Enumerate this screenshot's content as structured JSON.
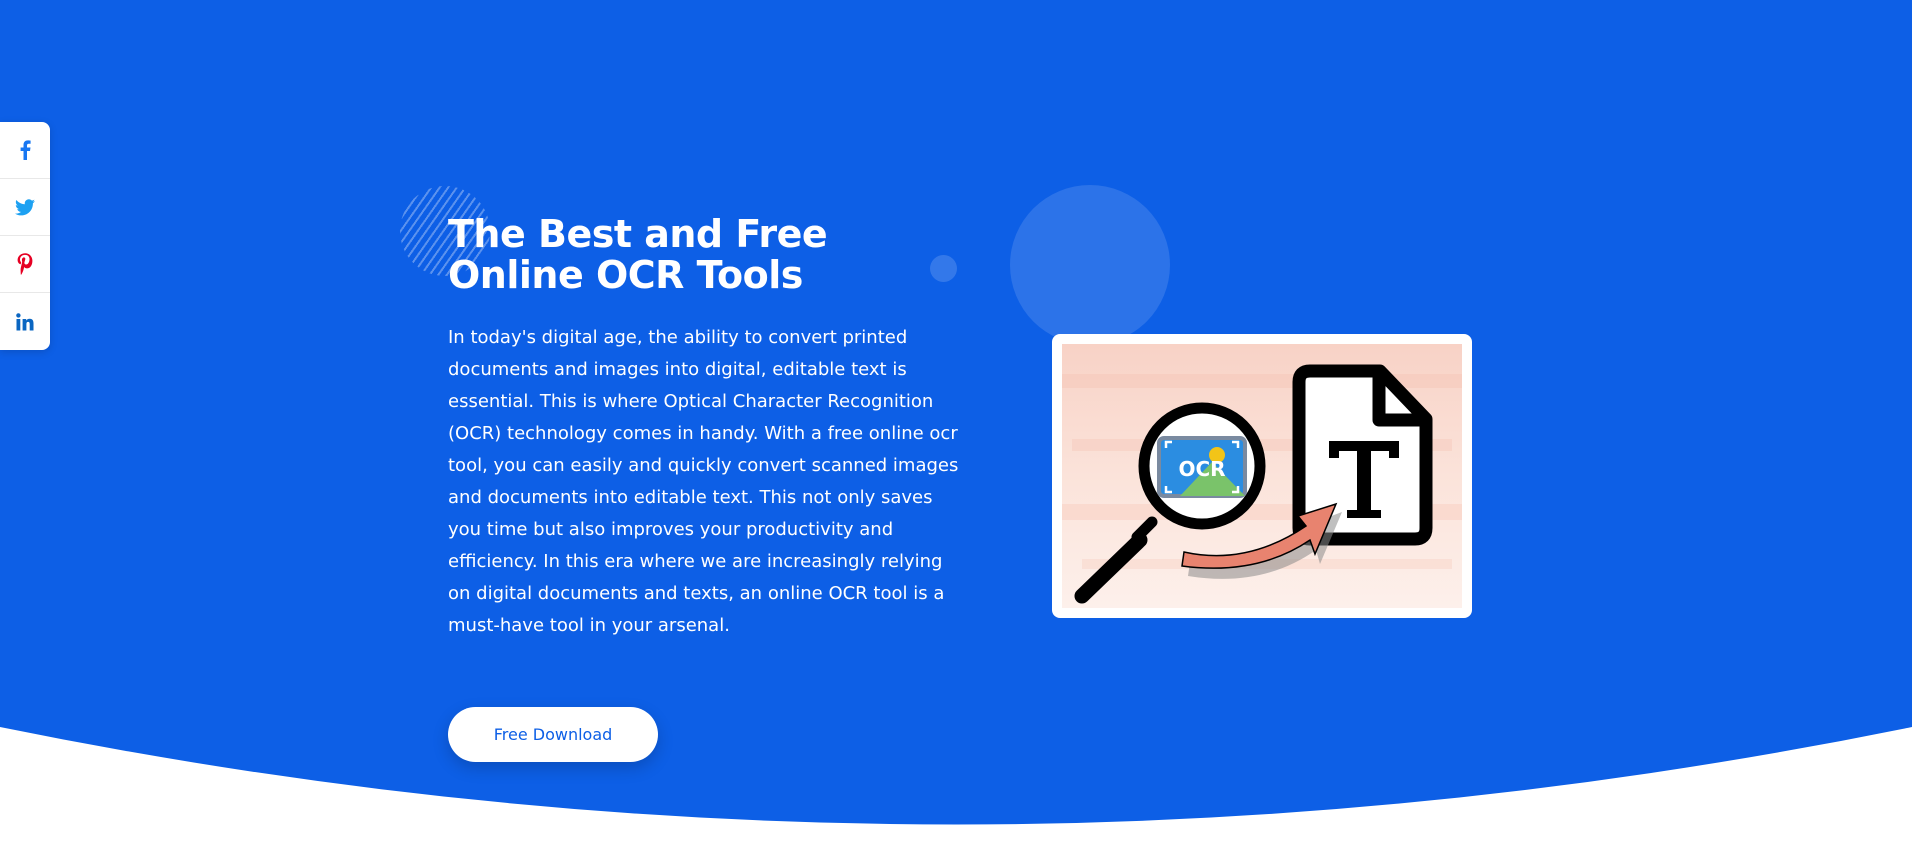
{
  "hero": {
    "title": "The Best and Free Online OCR Tools",
    "description": "In today's digital age, the ability to convert printed documents and images into digital, editable text is essential. This is where Optical Character Recognition (OCR) technology comes in handy. With a free online ocr tool, you can easily and quickly convert scanned images and documents into editable text. This not only saves you time but also improves your productivity and efficiency. In this era where we are increasingly relying on digital documents and texts, an online OCR tool is a must-have tool in your arsenal.",
    "cta_label": "Free Download",
    "illustration_label": "OCR"
  },
  "share": {
    "items": [
      {
        "icon": "facebook-icon",
        "color": "#1877f2"
      },
      {
        "icon": "twitter-icon",
        "color": "#1da1f2"
      },
      {
        "icon": "pinterest-icon",
        "color": "#e60023"
      },
      {
        "icon": "linkedin-icon",
        "color": "#0a66c2"
      }
    ]
  },
  "colors": {
    "background_blue": "#0d5fe6",
    "accent_salmon": "#e8836f",
    "white": "#ffffff"
  }
}
